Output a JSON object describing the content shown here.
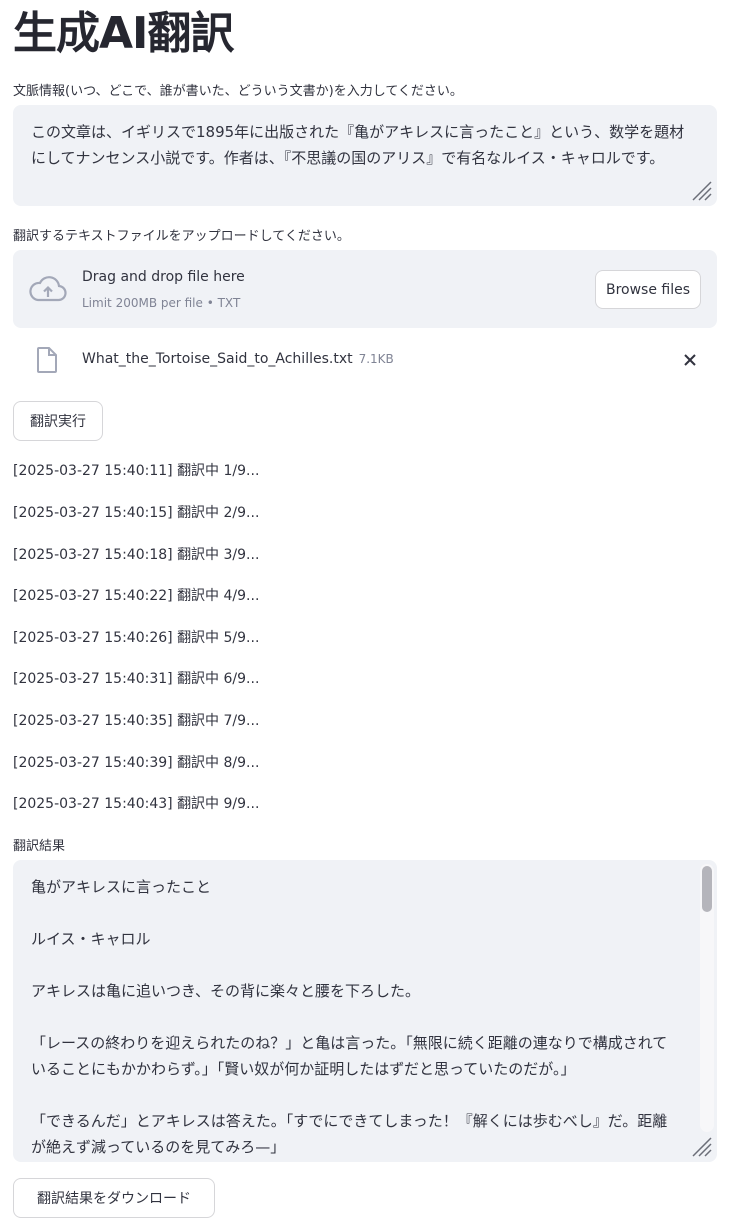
{
  "page": {
    "title": "生成AI翻訳"
  },
  "context": {
    "label": "文脈情報(いつ、どこで、誰が書いた、どういう文書か)を入力してください。",
    "value": "この文章は、イギリスで1895年に出版された『亀がアキレスに言ったこと』という、数学を題材にしてナンセンス小説です。作者は、『不思議の国のアリス』で有名なルイス・キャロルです。"
  },
  "upload": {
    "label": "翻訳するテキストファイルをアップロードしてください。",
    "drag_text": "Drag and drop file here",
    "limit_text": "Limit 200MB per file • TXT",
    "browse_label": "Browse files",
    "file_name": "What_the_Tortoise_Said_to_Achilles.txt",
    "file_size": "7.1KB"
  },
  "run_button": "翻訳実行",
  "logs": [
    "[2025-03-27 15:40:11] 翻訳中 1/9...",
    "[2025-03-27 15:40:15] 翻訳中 2/9...",
    "[2025-03-27 15:40:18] 翻訳中 3/9...",
    "[2025-03-27 15:40:22] 翻訳中 4/9...",
    "[2025-03-27 15:40:26] 翻訳中 5/9...",
    "[2025-03-27 15:40:31] 翻訳中 6/9...",
    "[2025-03-27 15:40:35] 翻訳中 7/9...",
    "[2025-03-27 15:40:39] 翻訳中 8/9...",
    "[2025-03-27 15:40:43] 翻訳中 9/9..."
  ],
  "result": {
    "label": "翻訳結果",
    "text": "亀がアキレスに言ったこと\n\nルイス・キャロル\n\nアキレスは亀に追いつき、その背に楽々と腰を下ろした。\n\n「レースの終わりを迎えられたのね？」と亀は言った。「無限に続く距離の連なりで構成されていることにもかかわらず。」「賢い奴が何か証明したはずだと思っていたのだが。」\n\n「できるんだ」とアキレスは答えた。「すでにできてしまった！『解くには歩むべし』だ。距離が絶えず減っているのを見てみろ—」"
  },
  "download_button": "翻訳結果をダウンロード",
  "icons": {
    "upload": "cloud-upload-icon",
    "file": "file-icon",
    "close": "close-icon",
    "resize": "resize-grip-icon"
  }
}
